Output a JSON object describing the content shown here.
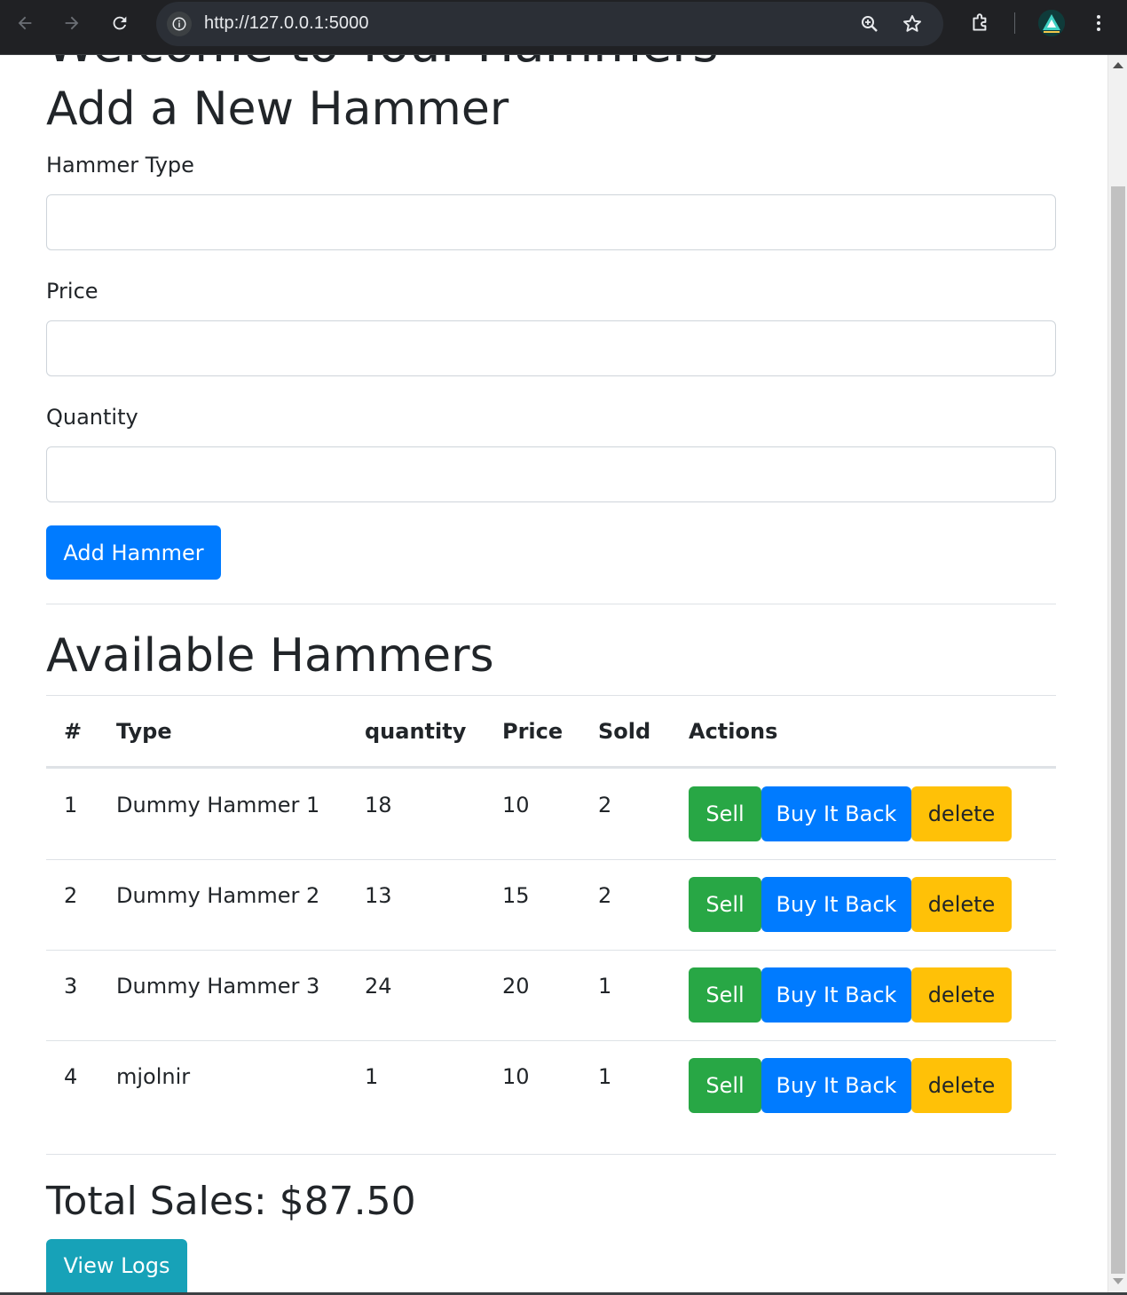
{
  "browser": {
    "url": "http://127.0.0.1:5000"
  },
  "page": {
    "cut_off_title": "Welcome to Your Hammers",
    "form": {
      "heading": "Add a New Hammer",
      "type_label": "Hammer Type",
      "type_value": "",
      "price_label": "Price",
      "price_value": "",
      "quantity_label": "Quantity",
      "quantity_value": "",
      "submit_label": "Add Hammer"
    },
    "inventory": {
      "heading": "Available Hammers",
      "columns": [
        "#",
        "Type",
        "quantity",
        "Price",
        "Sold",
        "Actions"
      ],
      "rows": [
        {
          "num": "1",
          "type": "Dummy Hammer 1",
          "quantity": "18",
          "price": "10",
          "sold": "2"
        },
        {
          "num": "2",
          "type": "Dummy Hammer 2",
          "quantity": "13",
          "price": "15",
          "sold": "2"
        },
        {
          "num": "3",
          "type": "Dummy Hammer 3",
          "quantity": "24",
          "price": "20",
          "sold": "1"
        },
        {
          "num": "4",
          "type": "mjolnir",
          "quantity": "1",
          "price": "10",
          "sold": "1"
        }
      ],
      "actions": {
        "sell": "Sell",
        "buy_back": "Buy It Back",
        "delete": "delete"
      }
    },
    "total_sales": "Total Sales: $87.50",
    "view_logs": "View Logs"
  },
  "colors": {
    "primary": "#007bff",
    "success": "#28a745",
    "warning": "#ffc107",
    "info": "#17a2b8"
  }
}
